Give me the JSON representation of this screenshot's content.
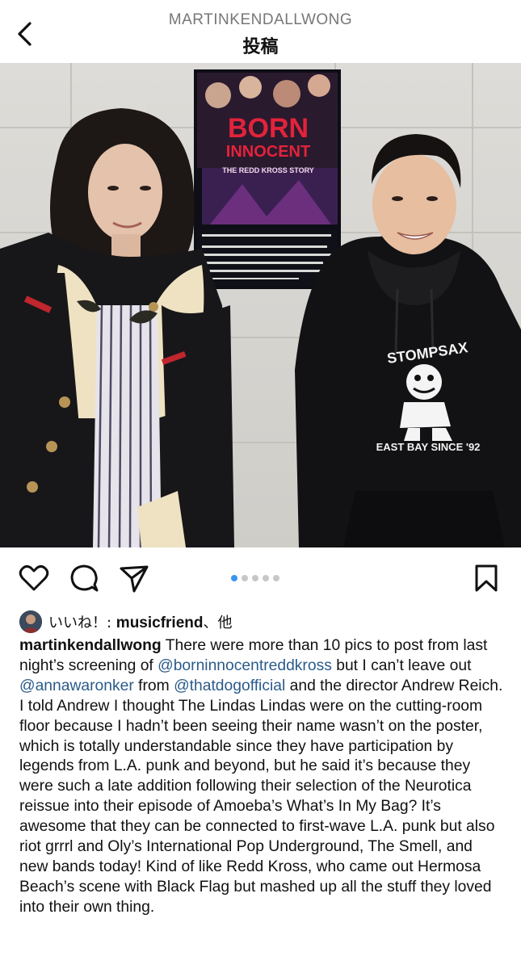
{
  "header": {
    "username": "MARTINKENDALLWONG",
    "title": "投稿"
  },
  "poster": {
    "title_line1": "BORN",
    "title_line2": "INNOCENT",
    "subtitle": "THE REDD KROSS STORY"
  },
  "hoodie": {
    "brand": "STOMPSAX",
    "tagline": "EAST BAY SINCE '92"
  },
  "carousel": {
    "count": 5,
    "active": 0
  },
  "likes": {
    "prefix": "いいね！: ",
    "user": "musicfriend",
    "suffix": "、他"
  },
  "caption": {
    "username": "martinkendallwong",
    "seg1": " There were more than 10 pics to post from last night’s screening of ",
    "mention1": "@borninnocentreddkross",
    "seg2": " but I can’t leave out ",
    "mention2": "@annawaronker",
    "seg3": " from ",
    "mention3": "@thatdogofficial",
    "seg4": " and the director Andrew Reich. I told Andrew I thought The Lindas Lindas were on the cutting-room floor because I hadn’t been seeing their name wasn’t on the poster, which is totally understandable since they have participation by legends from L.A. punk and beyond, but he said it’s because they were such a late addition following their selection of the Neurotica reissue into their episode of Amoeba’s What’s In My Bag? It’s awesome that they can be connected to first-wave L.A. punk but also riot grrrl and Oly’s International Pop Underground, The Smell, and new bands today! Kind of like Redd Kross, who came out Hermosa Beach’s scene with Black Flag but mashed up all the stuff they loved into their own thing."
  }
}
